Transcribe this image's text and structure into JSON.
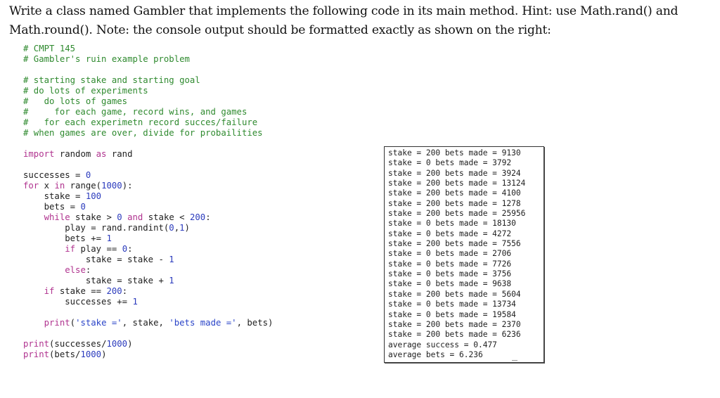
{
  "prompt": {
    "line1": "Write a class named Gambler that implements the following code in its main method. Hint: use Math.rand() and",
    "line2": "Math.round(). Note: the console output should be formatted exactly as shown on the right:"
  },
  "code": {
    "lines": [
      [
        {
          "t": "# CMPT 145",
          "c": "c"
        }
      ],
      [
        {
          "t": "# Gambler's ruin example problem",
          "c": "c"
        }
      ],
      [],
      [
        {
          "t": "# starting stake and starting goal",
          "c": "c"
        }
      ],
      [
        {
          "t": "# do lots of experiments",
          "c": "c"
        }
      ],
      [
        {
          "t": "#   do lots of games",
          "c": "c"
        }
      ],
      [
        {
          "t": "#     for each game, record wins, and games",
          "c": "c"
        }
      ],
      [
        {
          "t": "#   for each experimetn record succes/failure",
          "c": "c"
        }
      ],
      [
        {
          "t": "# when games are over, divide for probailities",
          "c": "c"
        }
      ],
      [],
      [
        {
          "t": "import",
          "c": "k"
        },
        {
          "t": " random "
        },
        {
          "t": "as",
          "c": "k"
        },
        {
          "t": " rand"
        }
      ],
      [],
      [
        {
          "t": "successes = "
        },
        {
          "t": "0",
          "c": "n"
        }
      ],
      [
        {
          "t": "for",
          "c": "k"
        },
        {
          "t": " x "
        },
        {
          "t": "in",
          "c": "k"
        },
        {
          "t": " range("
        },
        {
          "t": "1000",
          "c": "n"
        },
        {
          "t": "):"
        }
      ],
      [
        {
          "t": "    stake = "
        },
        {
          "t": "100",
          "c": "n"
        }
      ],
      [
        {
          "t": "    bets = "
        },
        {
          "t": "0",
          "c": "n"
        }
      ],
      [
        {
          "t": "    "
        },
        {
          "t": "while",
          "c": "k"
        },
        {
          "t": " stake > "
        },
        {
          "t": "0",
          "c": "n"
        },
        {
          "t": " "
        },
        {
          "t": "and",
          "c": "k"
        },
        {
          "t": " stake < "
        },
        {
          "t": "200",
          "c": "n"
        },
        {
          "t": ":"
        }
      ],
      [
        {
          "t": "        play = rand.randint("
        },
        {
          "t": "0",
          "c": "n"
        },
        {
          "t": ","
        },
        {
          "t": "1",
          "c": "n"
        },
        {
          "t": ")"
        }
      ],
      [
        {
          "t": "        bets += "
        },
        {
          "t": "1",
          "c": "n"
        }
      ],
      [
        {
          "t": "        "
        },
        {
          "t": "if",
          "c": "k"
        },
        {
          "t": " play == "
        },
        {
          "t": "0",
          "c": "n"
        },
        {
          "t": ":"
        }
      ],
      [
        {
          "t": "            stake = stake - "
        },
        {
          "t": "1",
          "c": "n"
        }
      ],
      [
        {
          "t": "        "
        },
        {
          "t": "else",
          "c": "k"
        },
        {
          "t": ":"
        }
      ],
      [
        {
          "t": "            stake = stake + "
        },
        {
          "t": "1",
          "c": "n"
        }
      ],
      [
        {
          "t": "    "
        },
        {
          "t": "if",
          "c": "k"
        },
        {
          "t": " stake == "
        },
        {
          "t": "200",
          "c": "n"
        },
        {
          "t": ":"
        }
      ],
      [
        {
          "t": "        successes += "
        },
        {
          "t": "1",
          "c": "n"
        }
      ],
      [],
      [
        {
          "t": "    "
        },
        {
          "t": "print",
          "c": "k"
        },
        {
          "t": "("
        },
        {
          "t": "'stake ='",
          "c": "s"
        },
        {
          "t": ", stake, "
        },
        {
          "t": "'bets made ='",
          "c": "s"
        },
        {
          "t": ", bets)"
        }
      ],
      [],
      [
        {
          "t": "print",
          "c": "k"
        },
        {
          "t": "(successes/"
        },
        {
          "t": "1000",
          "c": "n"
        },
        {
          "t": ")"
        }
      ],
      [
        {
          "t": "print",
          "c": "k"
        },
        {
          "t": "(bets/"
        },
        {
          "t": "1000",
          "c": "n"
        },
        {
          "t": ")"
        }
      ]
    ]
  },
  "console": {
    "lines": [
      "stake = 200 bets made = 9130",
      "stake = 0 bets made = 3792",
      "stake = 200 bets made = 3924",
      "stake = 200 bets made = 13124",
      "stake = 200 bets made = 4100",
      "stake = 200 bets made = 1278",
      "stake = 200 bets made = 25956",
      "stake = 0 bets made = 18130",
      "stake = 0 bets made = 4272",
      "stake = 200 bets made = 7556",
      "stake = 0 bets made = 2706",
      "stake = 0 bets made = 7726",
      "stake = 0 bets made = 3756",
      "stake = 0 bets made = 9638",
      "stake = 200 bets made = 5604",
      "stake = 0 bets made = 13734",
      "stake = 0 bets made = 19584",
      "stake = 200 bets made = 2370",
      "stake = 200 bets made = 6236",
      "average success = 0.477",
      "average bets = 6.236"
    ]
  }
}
